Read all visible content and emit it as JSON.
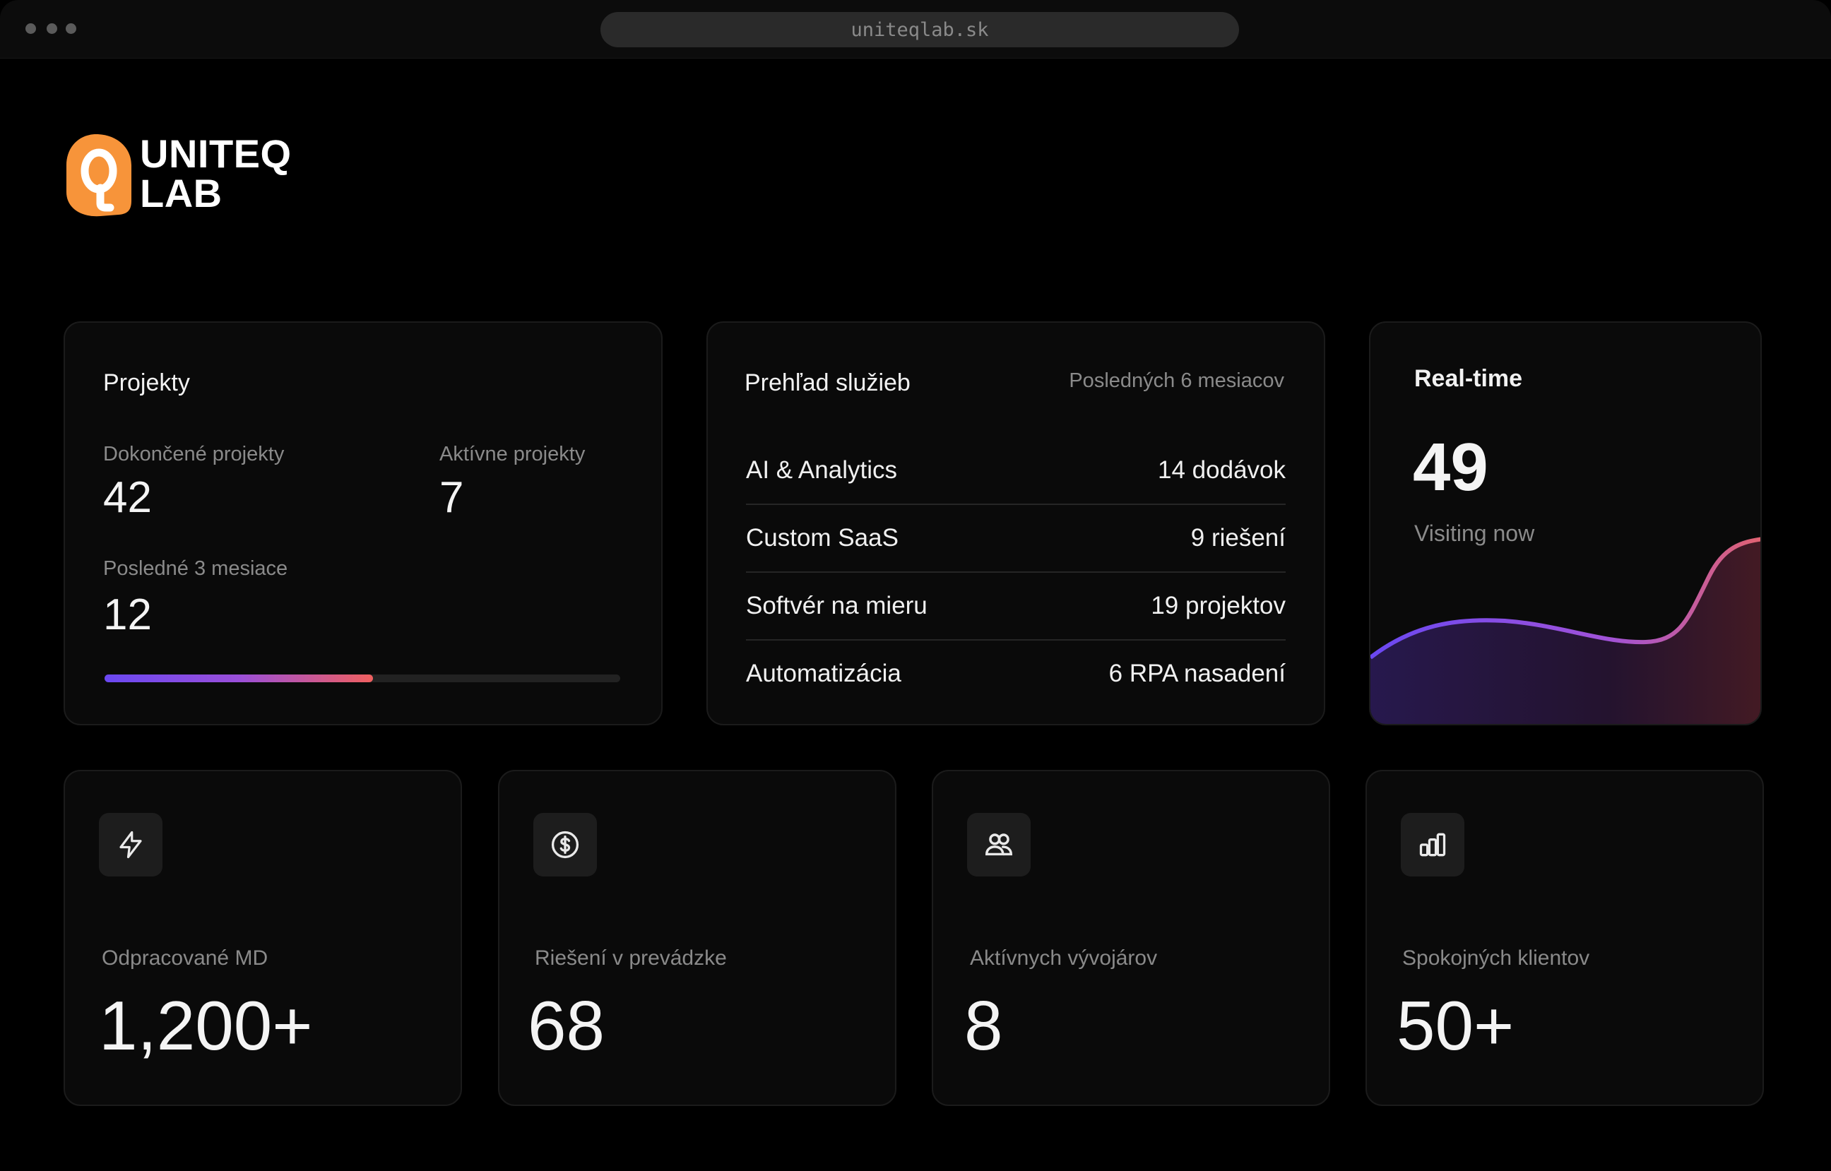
{
  "browser": {
    "url": "uniteqlab.sk"
  },
  "brand": {
    "line1": "UNITEQ",
    "line2": "LAB",
    "accent": "#f7943a"
  },
  "projects": {
    "title": "Projekty",
    "completed_label": "Dokončené projekty",
    "completed_value": "42",
    "active_label": "Aktívne projekty",
    "active_value": "7",
    "recent_label": "Posledné 3 mesiace",
    "recent_value": "12",
    "progress_fraction": 0.52
  },
  "services": {
    "title": "Prehľad služieb",
    "period": "Posledných 6 mesiacov",
    "rows": [
      {
        "name": "AI & Analytics",
        "value": "14 dodávok"
      },
      {
        "name": "Custom SaaS",
        "value": "9 riešení"
      },
      {
        "name": "Softvér na mieru",
        "value": "19 projektov"
      },
      {
        "name": "Automatizácia",
        "value": "6 RPA nasadení"
      }
    ]
  },
  "realtime": {
    "title": "Real-time",
    "value": "49",
    "caption": "Visiting now"
  },
  "stats": [
    {
      "icon": "bolt-icon",
      "label": "Odpracované MD",
      "value": "1,200+"
    },
    {
      "icon": "dollar-circle-icon",
      "label": "Riešení v prevádzke",
      "value": "68"
    },
    {
      "icon": "users-icon",
      "label": "Aktívnych vývojárov",
      "value": "8"
    },
    {
      "icon": "bar-chart-icon",
      "label": "Spokojných klientov",
      "value": "50+"
    }
  ]
}
